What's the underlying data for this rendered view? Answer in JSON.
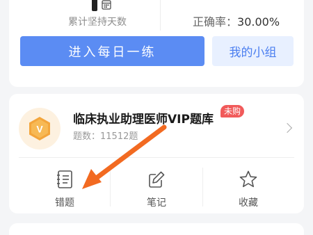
{
  "stats": {
    "streak_label": "累计坚持天数",
    "accuracy_label": "正确率：",
    "accuracy_value": "30.00%"
  },
  "actions": {
    "daily_practice": "进入每日一练",
    "my_group": "我的小组"
  },
  "question_bank": {
    "badge_letter": "V",
    "title": "临床执业助理医师VIP题库",
    "status_tag": "未购",
    "count_text": "题数：11512题"
  },
  "tools": [
    {
      "label": "错题",
      "icon": "notebook-icon"
    },
    {
      "label": "笔记",
      "icon": "edit-note-icon"
    },
    {
      "label": "收藏",
      "icon": "star-icon"
    }
  ],
  "colors": {
    "primary": "#5b8cf3",
    "secondary_bg": "#e8f0ff",
    "tag_red": "#f15a5a",
    "badge_gold": "#f3a53c",
    "annotation_arrow": "#f26a21"
  }
}
